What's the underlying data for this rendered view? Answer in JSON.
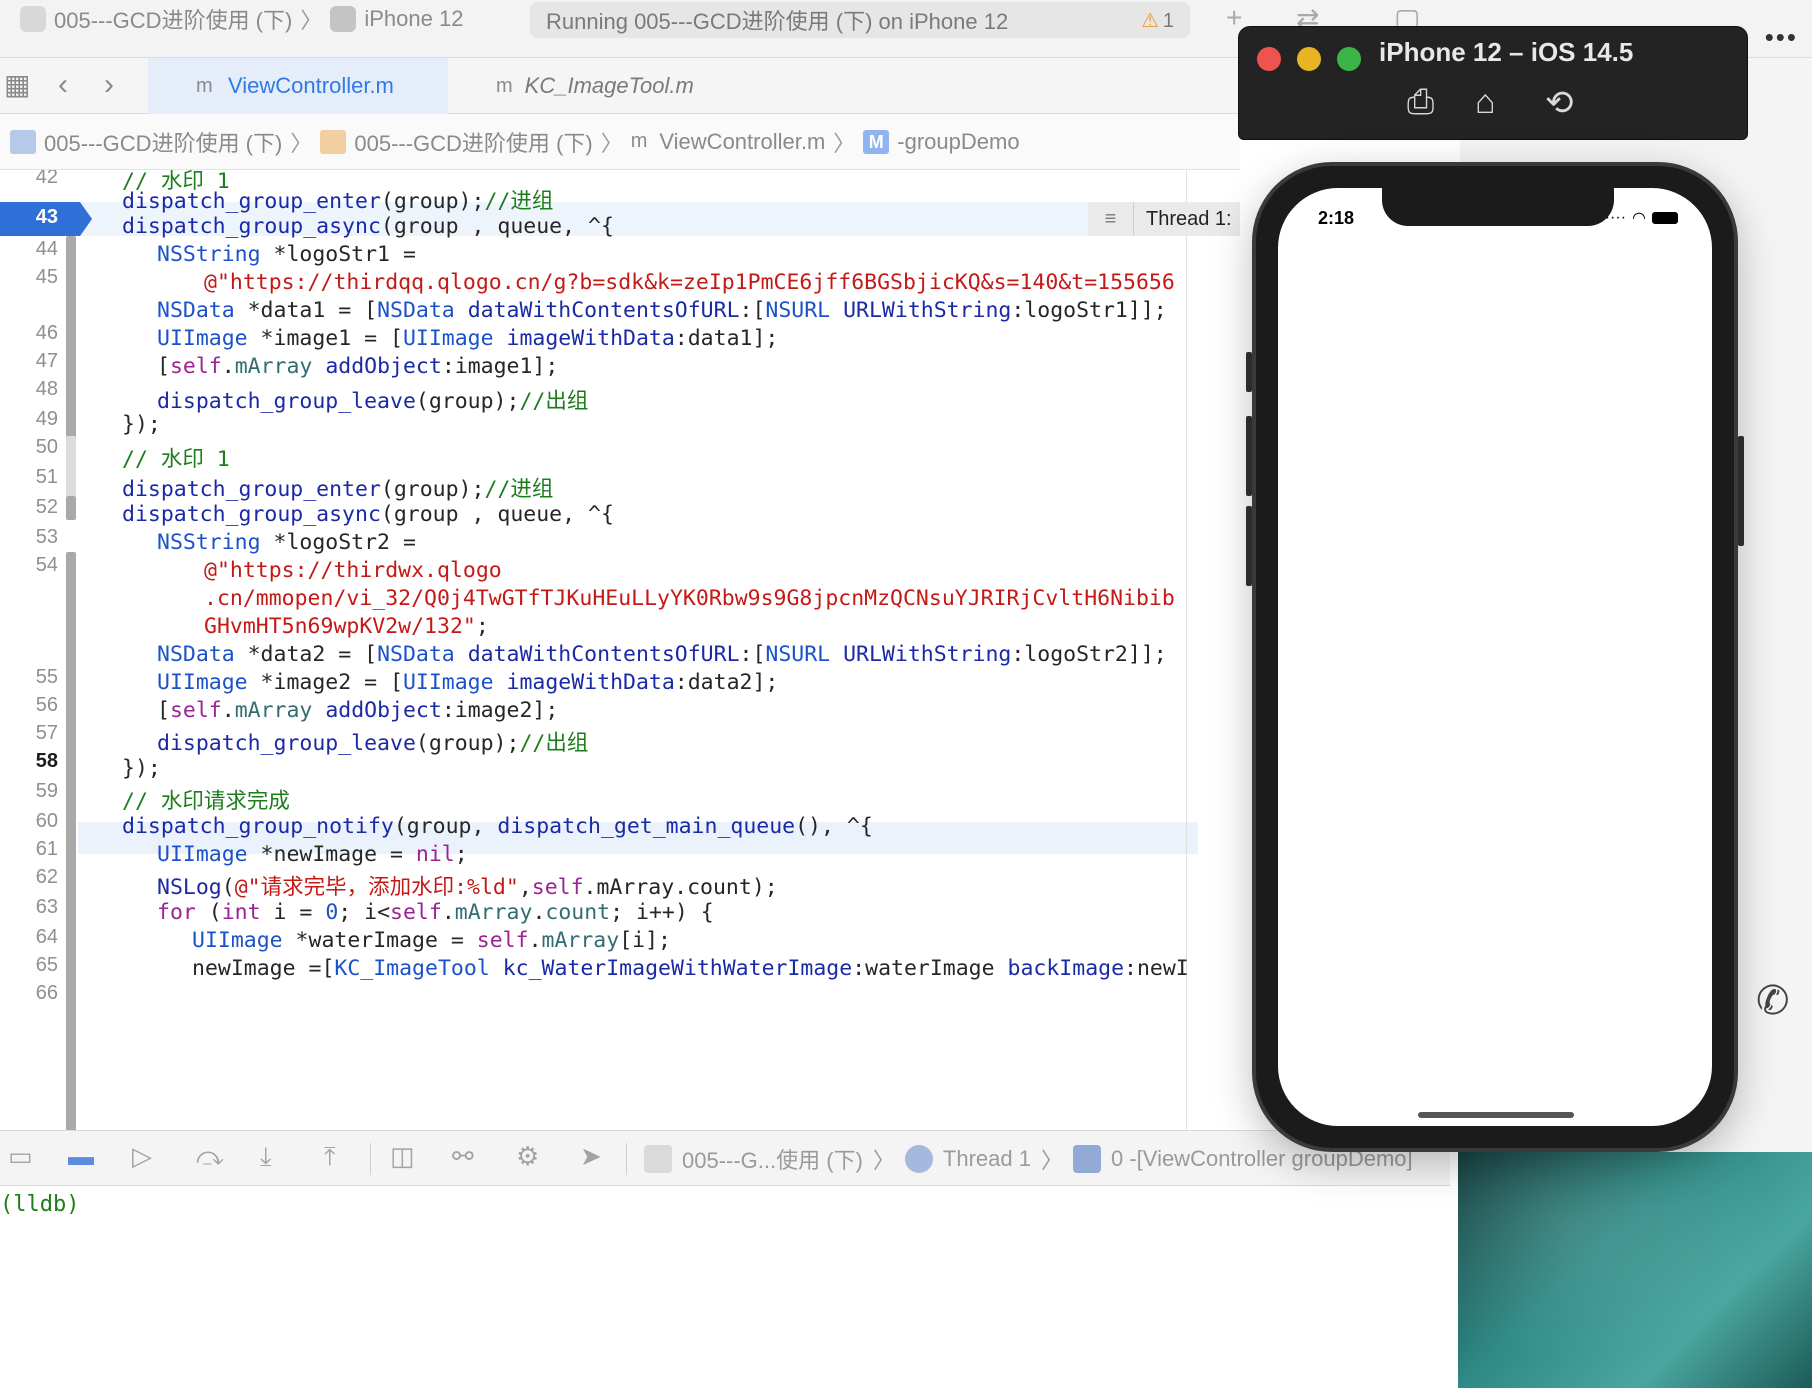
{
  "toolbar": {
    "scheme": "005---GCD进阶使用 (下)",
    "device": "iPhone 12",
    "run_status": "Running 005---GCD进阶使用 (下) on iPhone 12",
    "warning_count": "1"
  },
  "tabs": [
    {
      "label": "ViewController.m",
      "active": true
    },
    {
      "label": "KC_ImageTool.m",
      "active": false
    }
  ],
  "breadcrumb": {
    "project": "005---GCD进阶使用 (下)",
    "folder": "005---GCD进阶使用 (下)",
    "file": "ViewController.m",
    "method": "-groupDemo"
  },
  "editor": {
    "line_numbers": [
      "42",
      "43",
      "44",
      "45",
      "46",
      "47",
      "48",
      "49",
      "50",
      "51",
      "52",
      "53",
      "54",
      "55",
      "56",
      "57",
      "58",
      "59",
      "60",
      "61",
      "62",
      "63",
      "64",
      "65",
      "66"
    ],
    "current_line": "58",
    "breakpoint_line": "43",
    "thread_badge": "Thread 1: "
  },
  "debug": {
    "path_target": "005---G...使用 (下)",
    "path_thread": "Thread 1",
    "path_frame": "0 -[ViewController groupDemo]"
  },
  "console": {
    "prompt": "(lldb)"
  },
  "simulator": {
    "title": "iPhone 12 – iOS 14.5",
    "status_time": "2:18"
  },
  "colors": {
    "keyword": "#9b2393",
    "type": "#1c52c9",
    "function": "#1a2aa6",
    "string": "#c41a16",
    "comment": "#1d7d1d",
    "accent": "#2f7ae5"
  }
}
